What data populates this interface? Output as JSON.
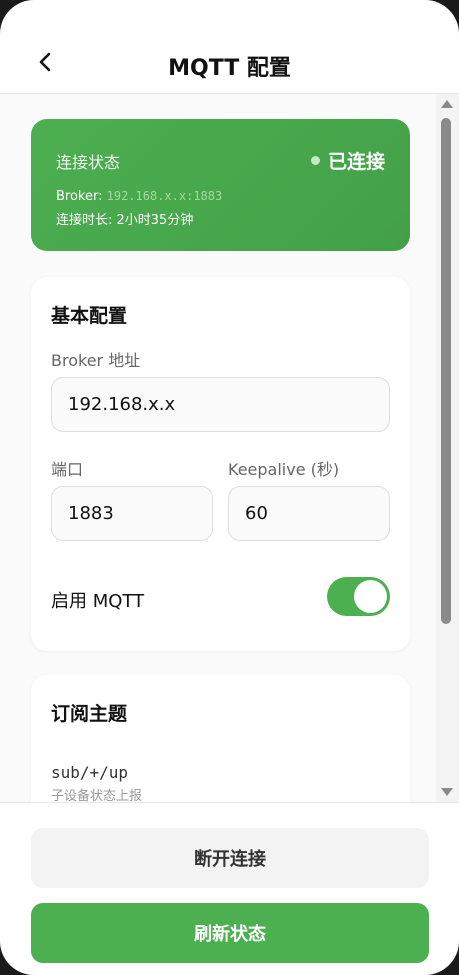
{
  "header": {
    "title": "MQTT 配置"
  },
  "status": {
    "label": "连接状态",
    "value": "已连接",
    "broker_label": "Broker: ",
    "broker_address": "192.168.x.x:1883",
    "duration": "连接时长: 2小时35分钟"
  },
  "basic": {
    "title": "基本配置",
    "broker_label": "Broker 地址",
    "broker_value": "192.168.x.x",
    "port_label": "端口",
    "port_value": "1883",
    "keepalive_label": "Keepalive (秒)",
    "keepalive_value": "60",
    "enable_label": "启用 MQTT",
    "enabled": true
  },
  "topics": {
    "title": "订阅主题",
    "items": [
      {
        "path": "sub/+/up",
        "desc": "子设备状态上报"
      }
    ]
  },
  "footer": {
    "disconnect_label": "断开连接",
    "refresh_label": "刷新状态"
  },
  "colors": {
    "accent": "#4caf50",
    "status_card": "#43a047"
  },
  "icons": {
    "back": "chevron-left-icon"
  }
}
